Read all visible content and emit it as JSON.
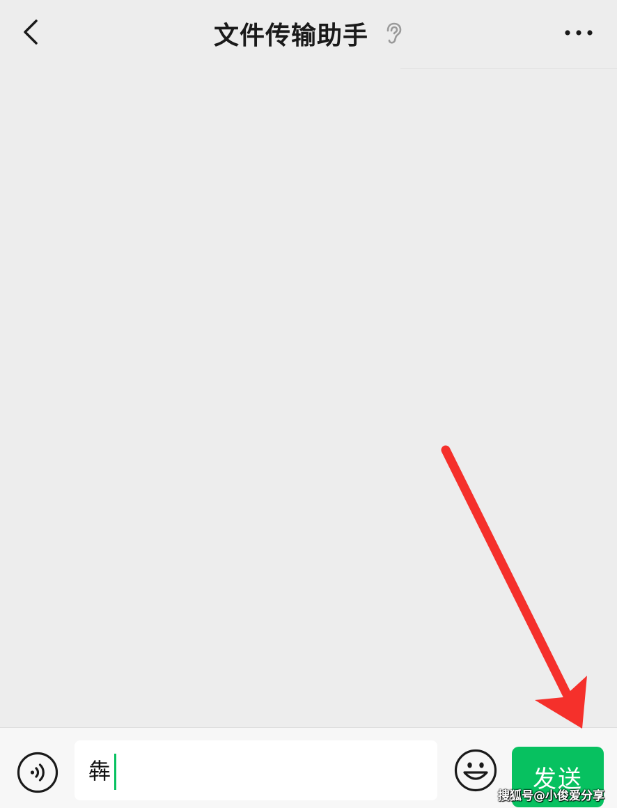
{
  "header": {
    "title": "文件传输助手",
    "back_icon": "chevron-left-icon",
    "ear_icon": "ear-icon",
    "more_icon": "more-dots-icon"
  },
  "input_bar": {
    "voice_icon": "voice-input-icon",
    "text_value": "犇",
    "emoji_icon": "emoji-icon",
    "send_label": "发送"
  },
  "annotation": {
    "arrow_color": "#f5302b"
  },
  "watermark": {
    "text": "搜狐号@小俊爱分享"
  },
  "colors": {
    "background": "#ededed",
    "accent": "#07c160",
    "input_bar": "#f7f7f7"
  }
}
